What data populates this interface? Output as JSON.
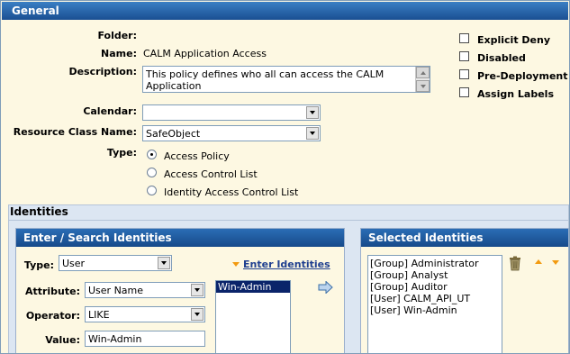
{
  "general": {
    "header": "General",
    "folder_label": "Folder:",
    "folder_value": "",
    "name_label": "Name:",
    "name_value": "CALM Application Access",
    "description_label": "Description:",
    "description_value": "This policy defines who all can access the CALM Application",
    "calendar_label": "Calendar:",
    "calendar_value": "",
    "resource_class_label": "Resource Class Name:",
    "resource_class_value": "SafeObject",
    "type_label": "Type:",
    "type_options": [
      "Access Policy",
      "Access Control List",
      "Identity Access Control List"
    ],
    "type_selected": "Access Policy",
    "flags": [
      "Explicit Deny",
      "Disabled",
      "Pre-Deployment",
      "Assign Labels"
    ]
  },
  "identities": {
    "header": "Identities",
    "enter_search": {
      "header": "Enter / Search Identities",
      "type_label": "Type:",
      "type_value": "User",
      "enter_link": "Enter Identities",
      "attribute_label": "Attribute:",
      "attribute_value": "User Name",
      "operator_label": "Operator:",
      "operator_value": "LIKE",
      "value_label": "Value:",
      "value_value": "Win-Admin",
      "results": [
        "Win-Admin"
      ]
    },
    "selected": {
      "header": "Selected Identities",
      "items": [
        "[Group] Administrator",
        "[Group] Analyst",
        "[Group] Auditor",
        "[User] CALM_API_UT",
        "[User] Win-Admin"
      ]
    }
  },
  "colors": {
    "header_blue": "#1a4f92",
    "panel_bg": "#fdf8e2",
    "accent_orange": "#f29a10"
  }
}
